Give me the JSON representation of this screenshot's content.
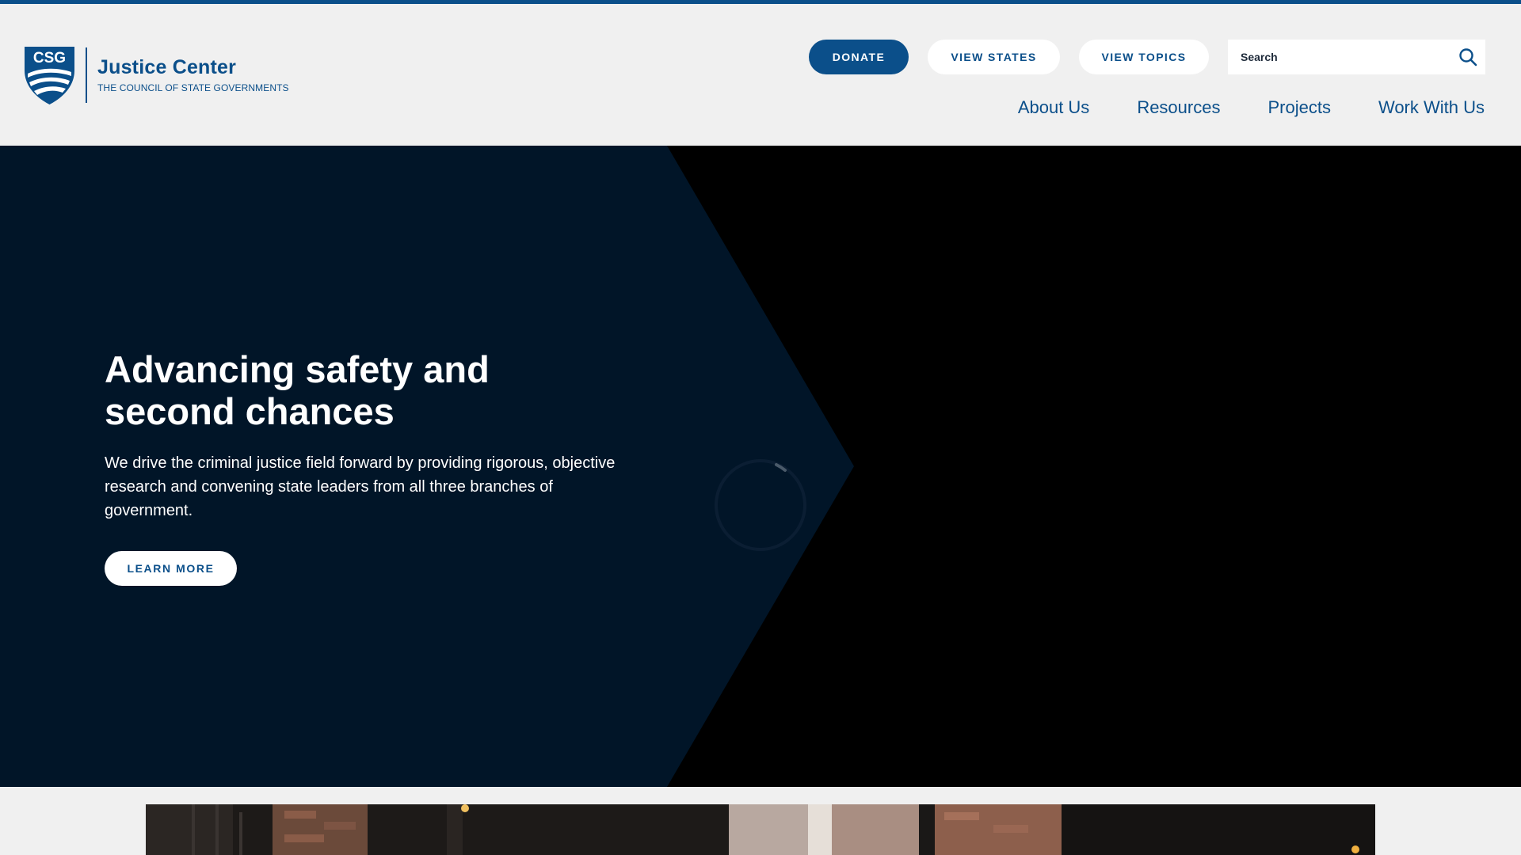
{
  "branding": {
    "mark_text": "CSG",
    "name": "Justice Center",
    "subtitle": "THE COUNCIL OF STATE GOVERNMENTS",
    "brand_color": "#0b4f8a",
    "hero_bg": "#011528"
  },
  "utility": {
    "donate_label": "DONATE",
    "view_states_label": "VIEW STATES",
    "view_topics_label": "VIEW TOPICS"
  },
  "search": {
    "placeholder": "Search",
    "icon": "search-icon"
  },
  "nav": {
    "items": [
      {
        "label": "About Us"
      },
      {
        "label": "Resources"
      },
      {
        "label": "Projects"
      },
      {
        "label": "Work With Us"
      }
    ]
  },
  "hero": {
    "title": "Advancing safety and second chances",
    "body": "We drive the criminal justice field forward by providing rigorous, objective research and convening state leaders from all three branches of government.",
    "cta_label": "LEARN MORE",
    "spinner_icon": "loading-spinner-icon"
  }
}
